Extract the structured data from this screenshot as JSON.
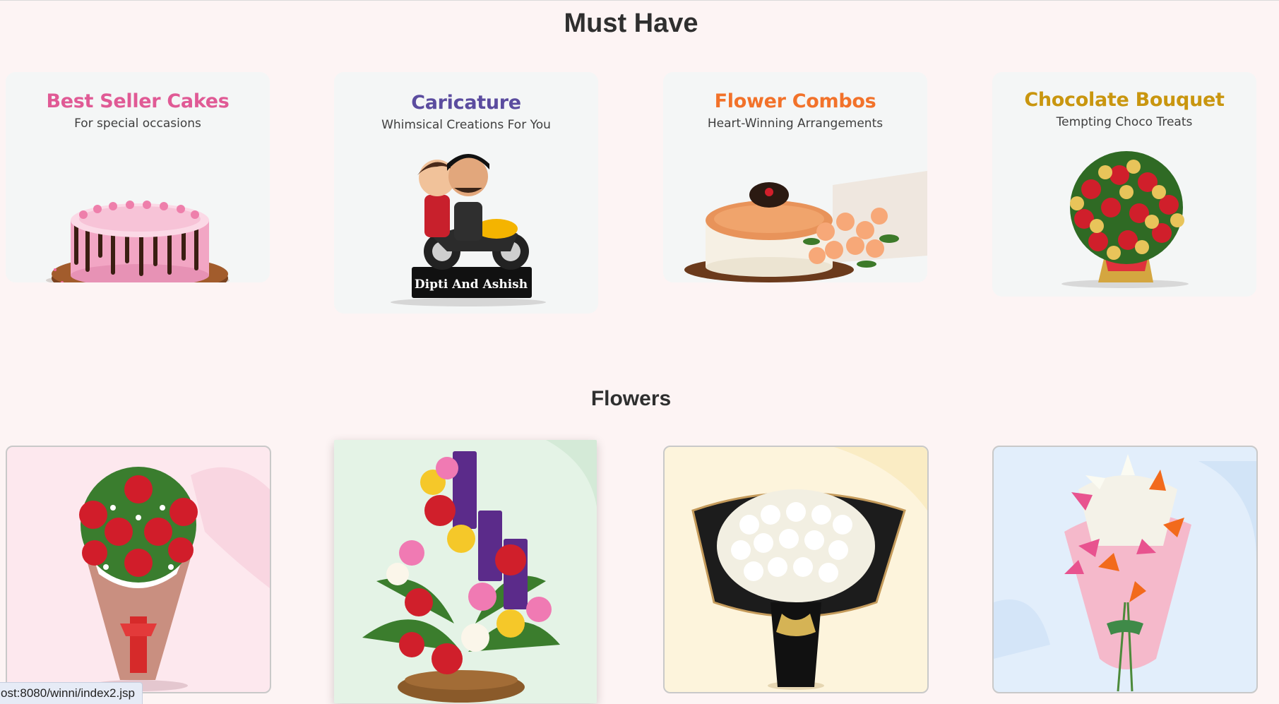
{
  "must_have": {
    "title": "Must Have",
    "cards": [
      {
        "title": "Best Seller Cakes",
        "subtitle": "For special occasions",
        "color": "#e05a95",
        "image": "pink-drip-cake"
      },
      {
        "title": "Caricature",
        "subtitle": "Whimsical Creations For You",
        "color": "#5b4c9f",
        "image": "couple-caricature-on-motorbike",
        "plaque_text": "Dipti And Ashish"
      },
      {
        "title": "Flower Combos",
        "subtitle": "Heart-Winning Arrangements",
        "color": "#f2722a",
        "image": "cake-with-peach-roses"
      },
      {
        "title": "Chocolate Bouquet",
        "subtitle": "Tempting Choco Treats",
        "color": "#c9960f",
        "image": "roses-and-chocolate-bouquet"
      }
    ]
  },
  "flowers": {
    "title": "Flowers",
    "cards": [
      {
        "image": "red-rose-bouquet",
        "bg": "#fde8ee"
      },
      {
        "image": "mixed-rose-basket-with-dairy-milk",
        "bg": "#e4f3e6"
      },
      {
        "image": "white-rose-black-wrap-bouquet",
        "bg": "#fdf4dc"
      },
      {
        "image": "lily-bouquet-pink-wrap",
        "bg": "#e2eefb"
      }
    ]
  },
  "status_bar": {
    "url": "ost:8080/winni/index2.jsp"
  }
}
